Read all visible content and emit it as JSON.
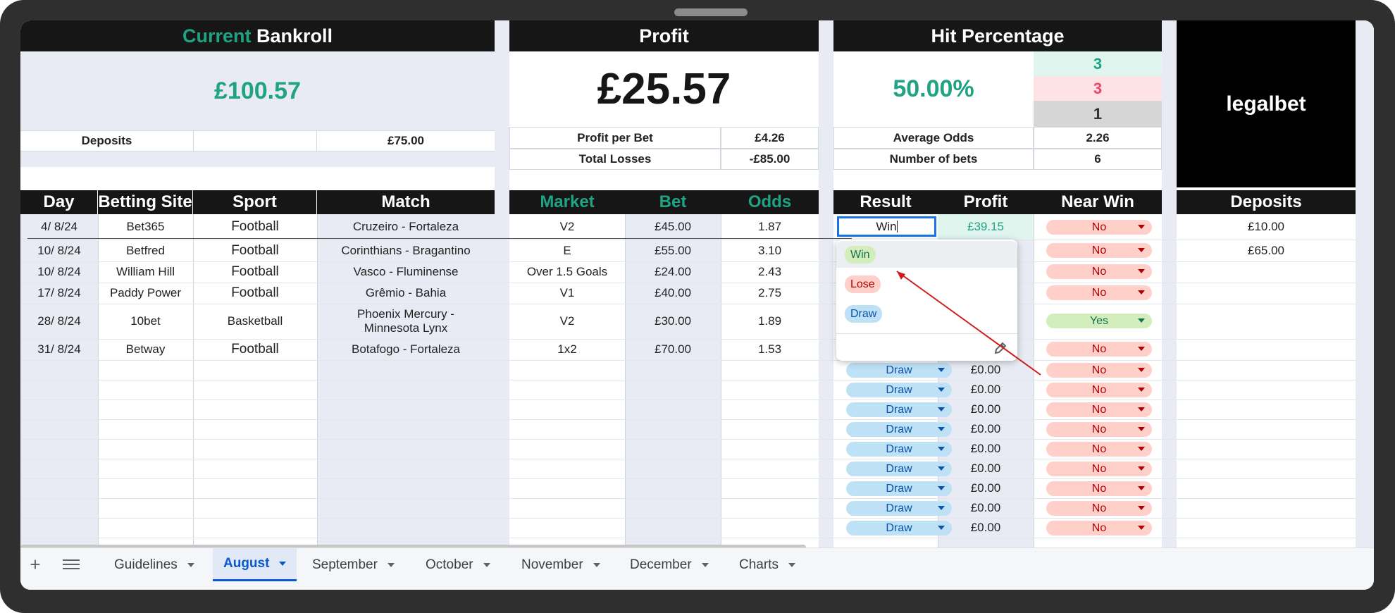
{
  "bankroll": {
    "title_part1": "Current",
    "title_part2": "Bankroll",
    "value": "£100.57",
    "deposits_label": "Deposits",
    "deposits_value": "£75.00"
  },
  "profit": {
    "title": "Profit",
    "value": "£25.57",
    "per_bet_label": "Profit per Bet",
    "per_bet_value": "£4.26",
    "losses_label": "Total Losses",
    "losses_value": "-£85.00"
  },
  "hit": {
    "title": "Hit Percentage",
    "value": "50.00%",
    "wins": "3",
    "losses": "3",
    "draws": "1",
    "avg_odds_label": "Average Odds",
    "avg_odds_value": "2.26",
    "num_bets_label": "Number of bets",
    "num_bets_value": "6"
  },
  "brand": {
    "name": "legalbet"
  },
  "headers": {
    "day": "Day",
    "site": "Betting Site",
    "sport": "Sport",
    "match": "Match",
    "market": "Market",
    "bet": "Bet",
    "odds": "Odds",
    "result": "Result",
    "profit": "Profit",
    "near_win": "Near Win",
    "deposits": "Deposits"
  },
  "rows": [
    {
      "day": "4/ 8/24",
      "site": "Bet365",
      "sport": "Football",
      "match": "Cruzeiro - Fortaleza",
      "market": "V2",
      "bet": "£45.00",
      "odds": "1.87",
      "result": "Win",
      "profit": "£39.15",
      "near_win": "No"
    },
    {
      "day": "10/ 8/24",
      "site": "Betfred",
      "sport": "Football",
      "match": "Corinthians - Bragantino",
      "market": "E",
      "bet": "£55.00",
      "odds": "3.10",
      "near_win": "No"
    },
    {
      "day": "10/ 8/24",
      "site": "William Hill",
      "sport": "Football",
      "match": "Vasco - Fluminense",
      "market": "Over 1.5 Goals",
      "bet": "£24.00",
      "odds": "2.43",
      "near_win": "No"
    },
    {
      "day": "17/ 8/24",
      "site": "Paddy Power",
      "sport": "Football",
      "match": "Grêmio - Bahia",
      "market": "V1",
      "bet": "£40.00",
      "odds": "2.75",
      "near_win": "No"
    },
    {
      "day": "28/ 8/24",
      "site": "10bet",
      "sport": "Basketball",
      "match_line1": "Phoenix Mercury -",
      "match_line2": "Minnesota Lynx",
      "market": "V2",
      "bet": "£30.00",
      "odds": "1.89",
      "near_win": "Yes"
    },
    {
      "day": "31/ 8/24",
      "site": "Betway",
      "sport": "Football",
      "match": "Botafogo - Fortaleza",
      "market": "1x2",
      "bet": "£70.00",
      "odds": "1.53",
      "near_win": "No"
    }
  ],
  "empty_rows": {
    "result": "Draw",
    "profit": "£0.00",
    "near_win": "No"
  },
  "deposits_list": [
    "£10.00",
    "£65.00"
  ],
  "dropdown": {
    "options": [
      "Win",
      "Lose",
      "Draw"
    ]
  },
  "tabs": [
    "Guidelines",
    "August",
    "September",
    "October",
    "November",
    "December",
    "Charts"
  ],
  "active_tab": "August",
  "colors": {
    "accent_green": "#1fa383",
    "accent_red": "#ee4466",
    "header_black": "#161616",
    "active_tab": "#0b57d0"
  }
}
